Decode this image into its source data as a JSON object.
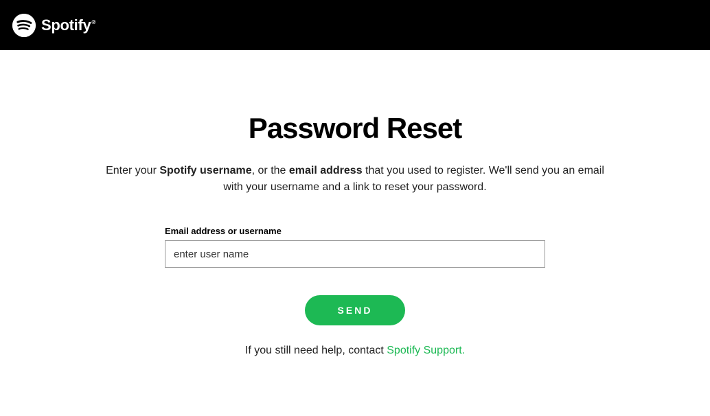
{
  "header": {
    "brand": "Spotify"
  },
  "main": {
    "title": "Password Reset",
    "subtitle_pre": "Enter your ",
    "subtitle_bold1": "Spotify username",
    "subtitle_mid": ", or the ",
    "subtitle_bold2": "email address",
    "subtitle_post": " that you used to register. We'll send you an email with your username and a link to reset your password."
  },
  "form": {
    "label": "Email address or username",
    "input_value": "enter user name",
    "send_label": "SEND"
  },
  "help": {
    "prefix": "If you still need help, contact ",
    "link_text": "Spotify Support."
  },
  "colors": {
    "accent": "#1db954",
    "header_bg": "#000000"
  }
}
